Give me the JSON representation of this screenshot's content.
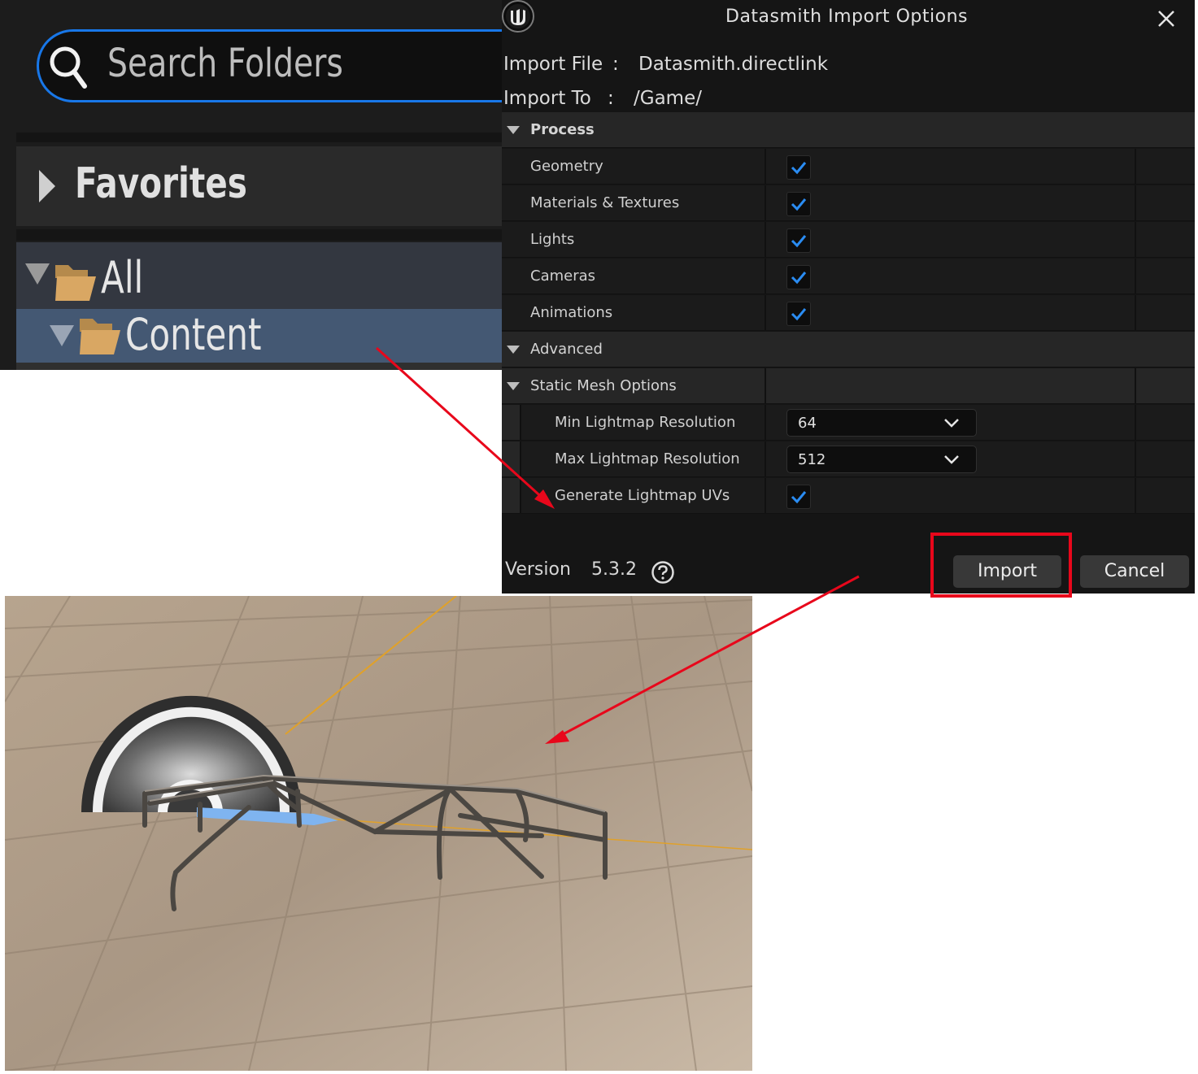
{
  "folder_panel": {
    "search": {
      "placeholder": "Search Folders"
    },
    "favorites_label": "Favorites",
    "tree": [
      {
        "label": "All",
        "expanded": true
      },
      {
        "label": "Content",
        "expanded": true,
        "selected": true
      }
    ]
  },
  "dialog": {
    "title": "Datasmith Import Options",
    "import_file_label": "Import File",
    "import_file_sep": ":",
    "import_file_value": "Datasmith.directlink",
    "import_to_label": "Import To",
    "import_to_sep": ":",
    "import_to_value": "/Game/",
    "sections": {
      "process": {
        "label": "Process",
        "options": [
          {
            "label": "Geometry",
            "checked": true
          },
          {
            "label": "Materials & Textures",
            "checked": true
          },
          {
            "label": "Lights",
            "checked": true
          },
          {
            "label": "Cameras",
            "checked": true
          },
          {
            "label": "Animations",
            "checked": true
          }
        ]
      },
      "advanced": {
        "label": "Advanced"
      },
      "static_mesh": {
        "label": "Static Mesh Options",
        "min_lightmap": {
          "label": "Min Lightmap Resolution",
          "value": "64"
        },
        "max_lightmap": {
          "label": "Max Lightmap Resolution",
          "value": "512"
        },
        "generate_uvs": {
          "label": "Generate Lightmap UVs",
          "checked": true
        }
      }
    },
    "version_label": "Version",
    "version_value": "5.3.2",
    "import_button": "Import",
    "cancel_button": "Cancel"
  },
  "colors": {
    "accent_blue": "#1877e8",
    "annotation_red": "#e8071b",
    "dialog_bg": "#151515",
    "selected_row": "#445873"
  },
  "icons": [
    "search-icon",
    "caret-right-icon",
    "caret-down-icon",
    "folder-icon",
    "unreal-logo-icon",
    "close-icon",
    "checkmark-icon",
    "chevron-down-icon",
    "help-icon"
  ]
}
